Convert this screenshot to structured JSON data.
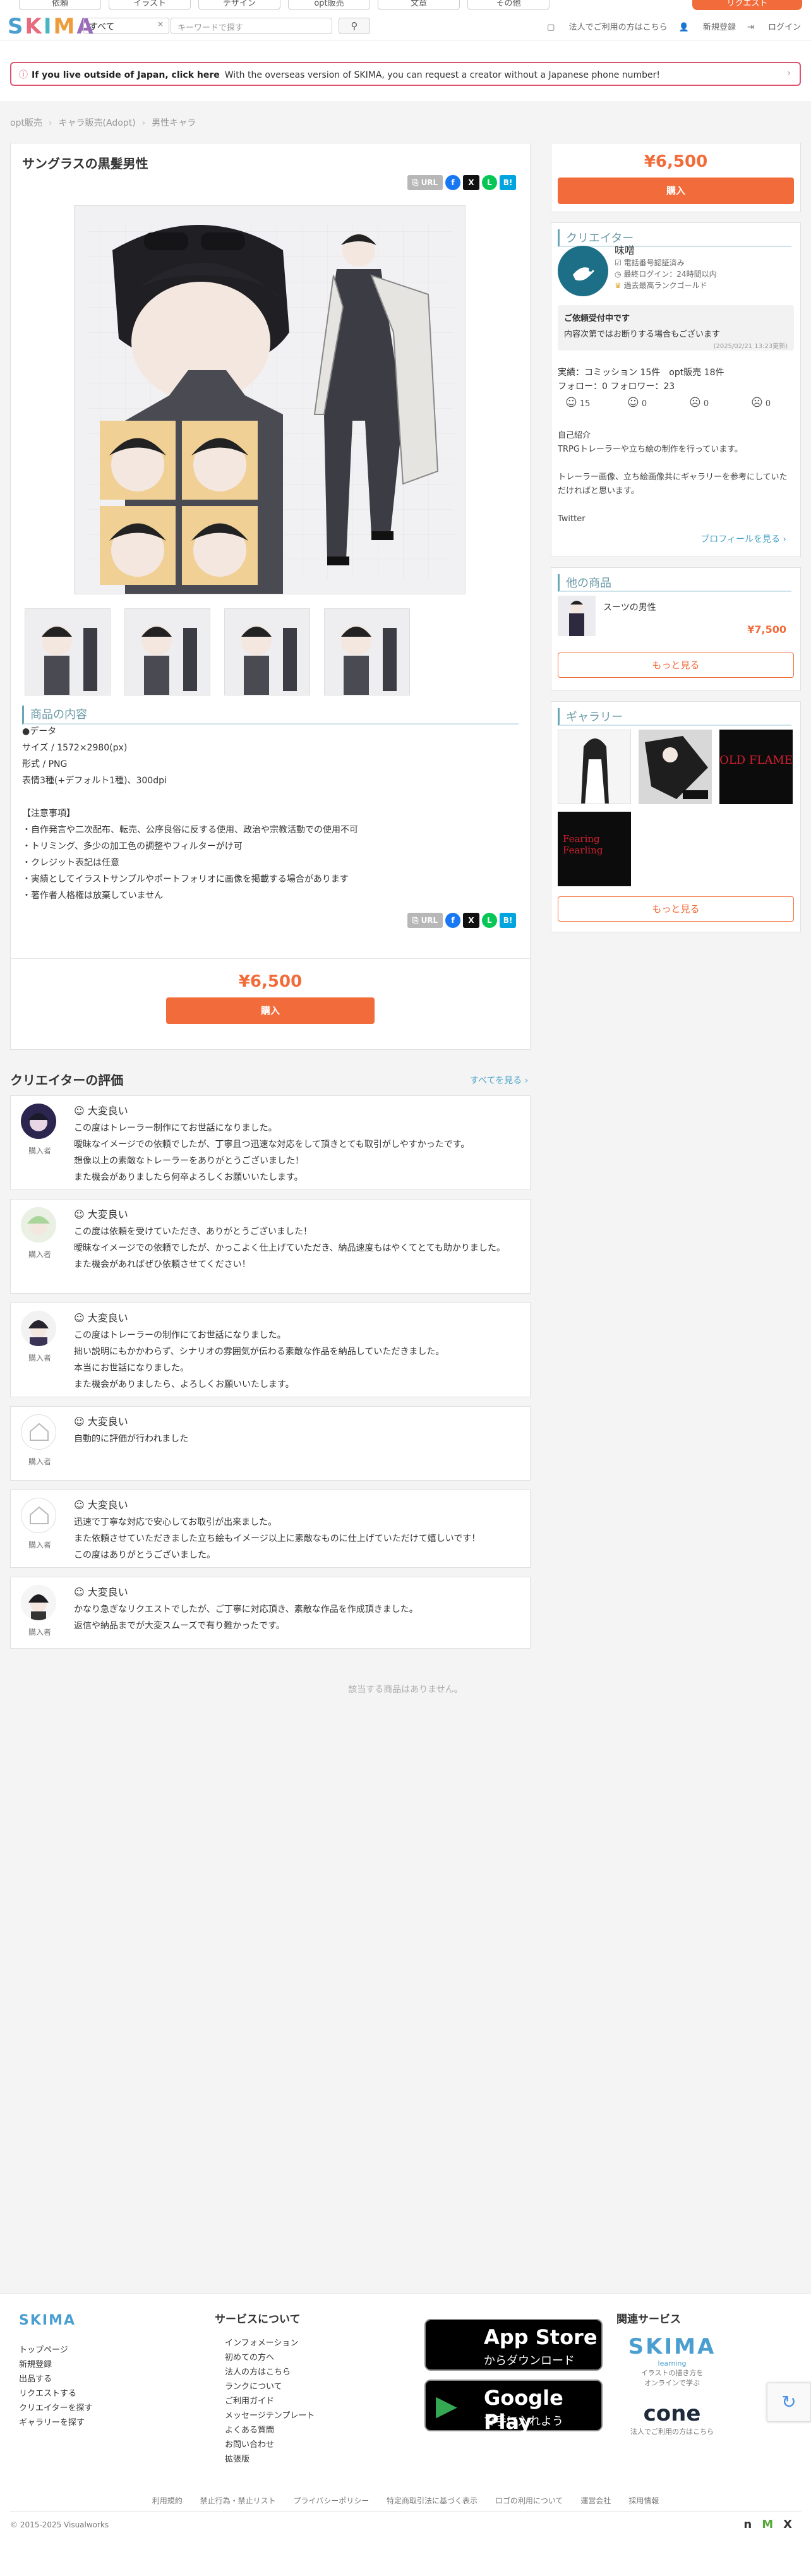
{
  "nav": {
    "categories": [
      "依頼",
      "イラスト",
      "デザイン",
      "opt販売",
      "文章",
      "その他"
    ],
    "request_label": "リクエスト"
  },
  "header": {
    "logo": [
      "S",
      "K",
      "I",
      "M",
      "A"
    ],
    "select_value": "すべて",
    "search_placeholder": "キーワードで探す",
    "links": [
      "法人でご利用の方はこちら",
      "新規登録",
      "ログイン"
    ]
  },
  "banner": {
    "bold": "If you live outside of Japan, click here",
    "text": "With the overseas version of SKIMA, you can request a creator without a Japanese phone number!"
  },
  "breadcrumb": [
    "opt販売",
    "キャラ販売(Adopt)",
    "男性キャラ"
  ],
  "product": {
    "title": "サングラスの黒髪男性",
    "share": {
      "url": "URL",
      "fb": "f",
      "x": "X",
      "line": "L",
      "hatena": "B!"
    },
    "section_title": "商品の内容",
    "description": "●データ\nサイズ / 1572×2980(px)\n形式 / PNG\n表情3種(+デフォルト1種)、300dpi\n\n【注意事項】\n・自作発言や二次配布、転売、公序良俗に反する使用、政治や宗教活動での使用不可\n・トリミング、多少の加工色の調整やフィルターがけ可\n・クレジット表記は任意\n・実績としてイラストサンプルやポートフォリオに画像を掲載する場合があります\n・著作者人格権は放棄していません",
    "price": "¥6,500",
    "buy_label": "購入"
  },
  "sidebar": {
    "price": "¥6,500",
    "buy_label": "購入",
    "creator": {
      "section_title": "クリエイター",
      "name": "味噌",
      "meta": [
        "電話番号認証済み",
        "最終ログイン：24時間以内",
        "過去最高ランクゴールド"
      ],
      "notice_title": "ご依頼受付中です",
      "notice_text": "内容次第ではお断りする場合もございます",
      "notice_date": "(2025/02/21 13:23更新)",
      "stats": "実績：コミッション 15件　opt販売 18件",
      "follow": "フォロー：0 フォロワー：23",
      "moods": [
        "15",
        "0",
        "0",
        "0"
      ],
      "intro": "自己紹介\nTRPGトレーラーや立ち絵の制作を行っています。\n\nトレーラー画像、立ち絵画像共にギャラリーを参考にしていただければと思います。\n\nTwitter",
      "profile_link": "プロフィールを見る ›"
    },
    "other": {
      "section_title": "他の商品",
      "item_name": "スーツの男性",
      "item_price": "¥7,500",
      "more_label": "もっと見る"
    },
    "gallery": {
      "section_title": "ギャラリー",
      "more_label": "もっと見る",
      "tile_texts": [
        "OLD FLAME",
        "Fearing Fearling"
      ]
    }
  },
  "reviews": {
    "title": "クリエイターの評価",
    "see_all": "すべてを見る ›",
    "badge": "購入者",
    "items": [
      {
        "rating": "大変良い",
        "text": "この度はトレーラー制作にてお世話になりました。\n曖昧なイメージでの依頼でしたが、丁寧且つ迅速な対応をして頂きとても取引がしやすかったです。\n想像以上の素敵なトレーラーをありがとうございました！\nまた機会がありましたら何卒よろしくお願いいたします。"
      },
      {
        "rating": "大変良い",
        "text": "この度は依頼を受けていただき、ありがとうございました！\n曖昧なイメージでの依頼でしたが、かっこよく仕上げていただき、納品速度もはやくてとても助かりました。\nまた機会があればぜひ依頼させてください！"
      },
      {
        "rating": "大変良い",
        "text": "この度はトレーラーの制作にてお世話になりました。\n拙い説明にもかかわらず、シナリオの雰囲気が伝わる素敵な作品を納品していただきました。\n本当にお世話になりました。\nまた機会がありましたら、よろしくお願いいたします。"
      },
      {
        "rating": "大変良い",
        "text": "自動的に評価が行われました"
      },
      {
        "rating": "大変良い",
        "text": "迅速で丁寧な対応で安心してお取引が出来ました。\nまた依頼させていただきました立ち絵もイメージ以上に素敵なものに仕上げていただけて嬉しいです！\nこの度はありがとうございました。"
      },
      {
        "rating": "大変良い",
        "text": "かなり急ぎなリクエストでしたが、ご丁寧に対応頂き、素敵な作品を作成頂きました。\n返信や納品までが大変スムーズで有り難かったです。"
      }
    ]
  },
  "empty_text": "該当する商品はありません。",
  "footer": {
    "logo": "SKIMA",
    "col1": [
      "トップページ",
      "新規登録",
      "出品する",
      "リクエストする",
      "クリエイターを探す",
      "ギャラリーを探す"
    ],
    "col2_title": "サービスについて",
    "col2": [
      "インフォメーション",
      "初めての方へ",
      "法人の方はこちら",
      "ランクについて",
      "ご利用ガイド",
      "メッセージテンプレート",
      "よくある質問",
      "お問い合わせ",
      "拡張版"
    ],
    "appstore": {
      "t1": "App Store",
      "t2": "からダウンロード"
    },
    "googleplay": {
      "t1": "Google Play",
      "t2": "で手に入れよう"
    },
    "related_title": "関連サービス",
    "skima_learning": {
      "name": "SKIMA",
      "sub": "learning",
      "desc": "イラストの描き方を\nオンラインで学ぶ"
    },
    "cone": {
      "name": "cone",
      "desc": "法人でご利用の方はこちら"
    },
    "bottom_links": [
      "利用規約",
      "禁止行為・禁止リスト",
      "プライバシーポリシー",
      "特定商取引法に基づく表示",
      "ロゴの利用について",
      "運営会社",
      "採用情報"
    ],
    "copyright": "© 2015-2025 Visualworks",
    "social": [
      "n",
      "M",
      "X"
    ]
  },
  "colors": {
    "accent": "#f26b3a",
    "teal": "#6aa6b8",
    "link": "#4aa3c8",
    "banner_border": "#e0536e"
  }
}
